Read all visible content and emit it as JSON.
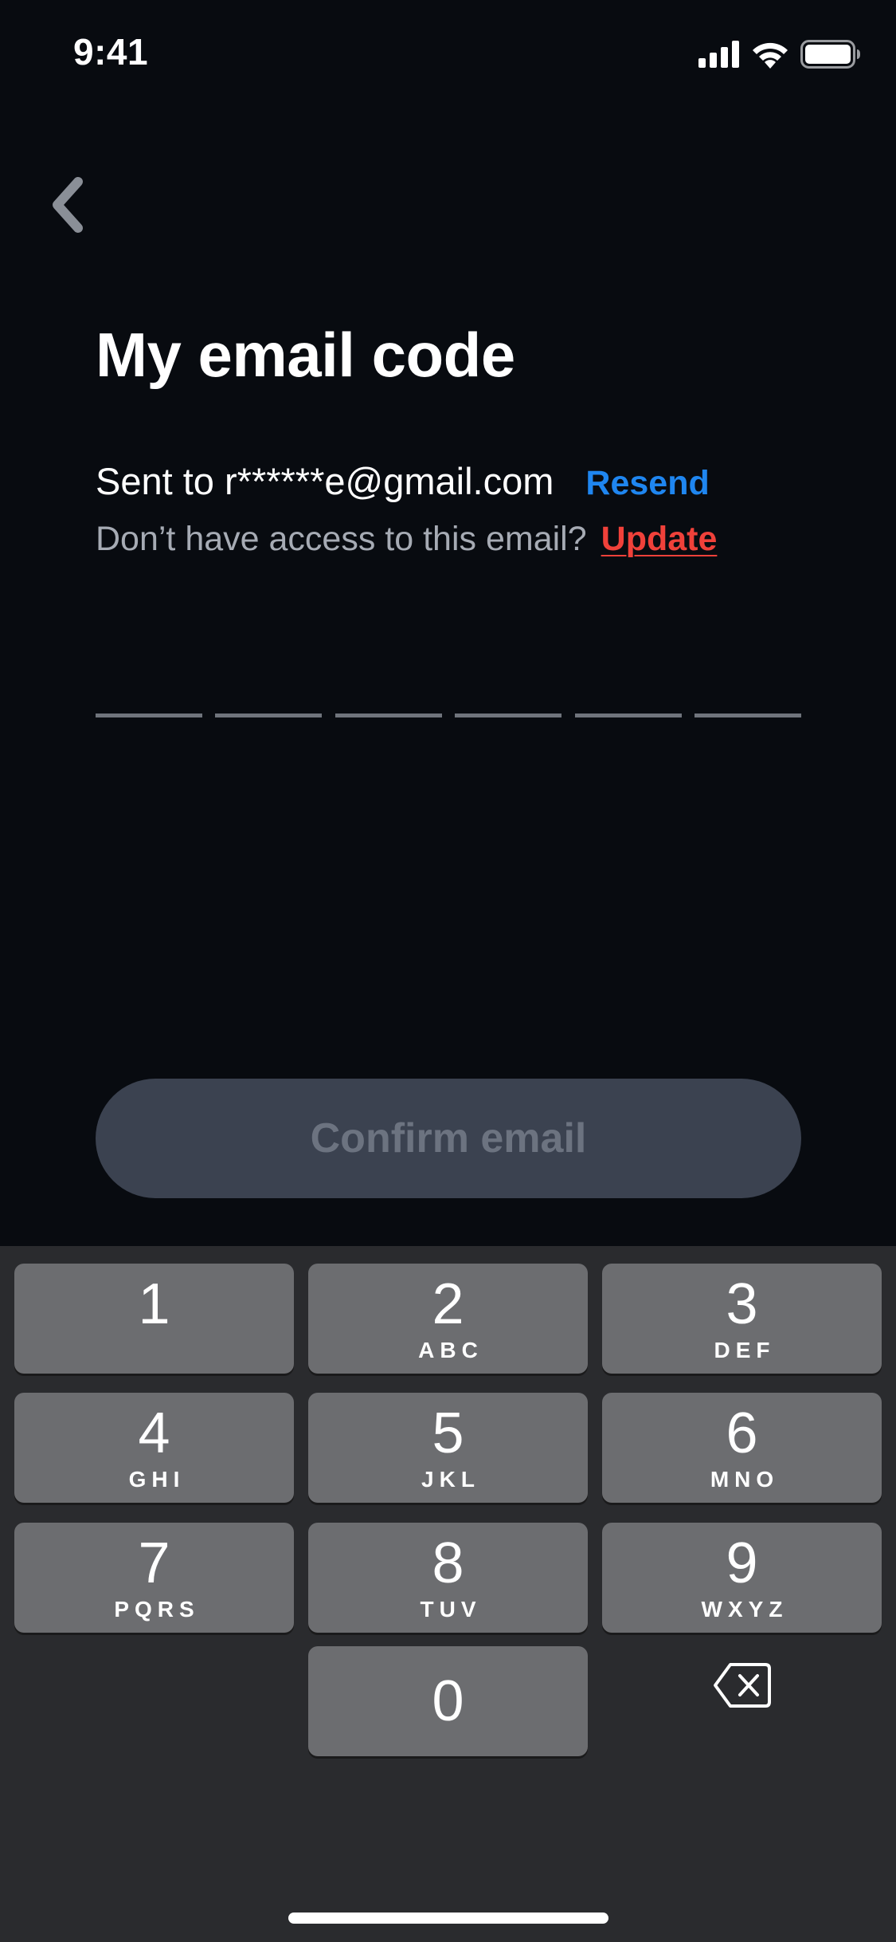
{
  "status_bar": {
    "time": "9:41",
    "icons": [
      "cellular-signal-icon",
      "wifi-icon",
      "battery-icon"
    ]
  },
  "header": {
    "back_icon": "chevron-left-icon",
    "title": "My email code"
  },
  "sent": {
    "label": "Sent to r******e@gmail.com",
    "resend_label": "Resend"
  },
  "access": {
    "label": "Don’t have access to this email?",
    "update_label": "Update"
  },
  "code": {
    "slots": [
      "",
      "",
      "",
      "",
      "",
      ""
    ]
  },
  "confirm": {
    "label": "Confirm email",
    "enabled": false
  },
  "keypad": {
    "keys": [
      {
        "num": "1",
        "letters": ""
      },
      {
        "num": "2",
        "letters": "ABC"
      },
      {
        "num": "3",
        "letters": "DEF"
      },
      {
        "num": "4",
        "letters": "GHI"
      },
      {
        "num": "5",
        "letters": "JKL"
      },
      {
        "num": "6",
        "letters": "MNO"
      },
      {
        "num": "7",
        "letters": "PQRS"
      },
      {
        "num": "8",
        "letters": "TUV"
      },
      {
        "num": "9",
        "letters": "WXYZ"
      },
      {
        "num": "0",
        "letters": ""
      }
    ],
    "backspace_icon": "backspace-icon"
  },
  "colors": {
    "background": "#080b10",
    "accent_blue": "#1f86f0",
    "accent_red": "#f0413a",
    "button_disabled": "#3b4250",
    "key": "#6c6d70",
    "keypad_bg": "#2a2b2e"
  }
}
